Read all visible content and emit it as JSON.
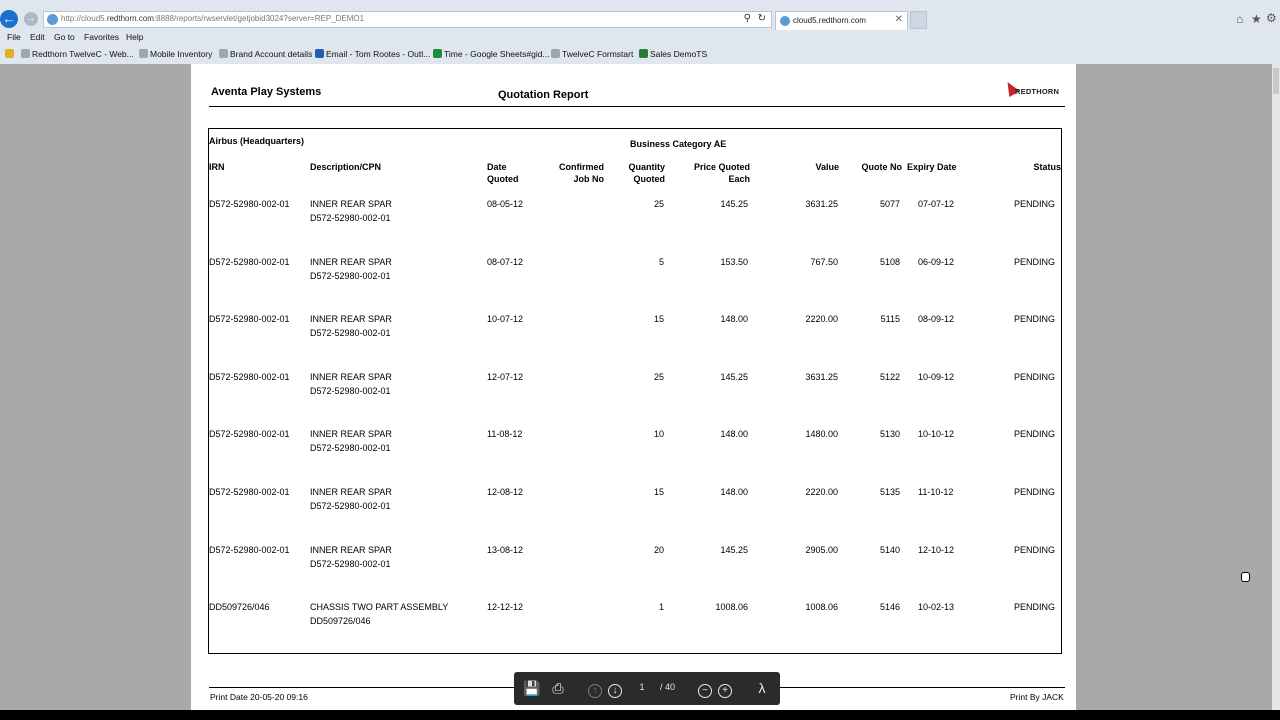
{
  "browser": {
    "url_prefix": "http://cloud5.",
    "url_domain": "redthorn.com",
    "url_suffix": ":8888/reports/rwservlet/getjobid3024?server=REP_DEMO1",
    "tab_title": "cloud5.redthorn.com",
    "menu": [
      "File",
      "Edit",
      "Go to",
      "Favorites",
      "Help"
    ],
    "favorites": [
      "Redthorn TwelveC - Web...",
      "Mobile Inventory",
      "Brand Account details",
      "Email - Tom Rootes - Outl...",
      "Time - Google Sheets#gid...",
      "TwelveC Formstart",
      "Sales DemoTS"
    ]
  },
  "report": {
    "company": "Aventa Play Systems",
    "title": "Quotation Report",
    "logo_text": "REDTHORN",
    "customer": "Airbus (Headquarters)",
    "category": "Business Category AE",
    "columns": {
      "irn": "IRN",
      "description": "Description/CPN",
      "date_quoted_1": "Date",
      "date_quoted_2": "Quoted",
      "confirmed_1": "Confirmed",
      "confirmed_2": "Job No",
      "quantity_1": "Quantity",
      "quantity_2": "Quoted",
      "price_1": "Price  Quoted",
      "price_2": "Each",
      "value": "Value",
      "quote_no": "Quote No",
      "expiry": "Expiry Date",
      "status": "Status"
    },
    "rows": [
      {
        "irn": "D572-52980-002-01",
        "desc": "INNER REAR SPAR",
        "cpn": "D572-52980-002-01",
        "date": "08-05-12",
        "qty": "25",
        "price": "145.25",
        "value": "3631.25",
        "quote_no": "5077",
        "expiry": "07-07-12",
        "status": "PENDING"
      },
      {
        "irn": "D572-52980-002-01",
        "desc": "INNER REAR SPAR",
        "cpn": "D572-52980-002-01",
        "date": "08-07-12",
        "qty": "5",
        "price": "153.50",
        "value": "767.50",
        "quote_no": "5108",
        "expiry": "06-09-12",
        "status": "PENDING"
      },
      {
        "irn": "D572-52980-002-01",
        "desc": "INNER REAR SPAR",
        "cpn": "D572-52980-002-01",
        "date": "10-07-12",
        "qty": "15",
        "price": "148.00",
        "value": "2220.00",
        "quote_no": "5115",
        "expiry": "08-09-12",
        "status": "PENDING"
      },
      {
        "irn": "D572-52980-002-01",
        "desc": "INNER REAR SPAR",
        "cpn": "D572-52980-002-01",
        "date": "12-07-12",
        "qty": "25",
        "price": "145.25",
        "value": "3631.25",
        "quote_no": "5122",
        "expiry": "10-09-12",
        "status": "PENDING"
      },
      {
        "irn": "D572-52980-002-01",
        "desc": "INNER REAR SPAR",
        "cpn": "D572-52980-002-01",
        "date": "11-08-12",
        "qty": "10",
        "price": "148.00",
        "value": "1480.00",
        "quote_no": "5130",
        "expiry": "10-10-12",
        "status": "PENDING"
      },
      {
        "irn": "D572-52980-002-01",
        "desc": "INNER REAR SPAR",
        "cpn": "D572-52980-002-01",
        "date": "12-08-12",
        "qty": "15",
        "price": "148.00",
        "value": "2220.00",
        "quote_no": "5135",
        "expiry": "11-10-12",
        "status": "PENDING"
      },
      {
        "irn": "D572-52980-002-01",
        "desc": "INNER REAR SPAR",
        "cpn": "D572-52980-002-01",
        "date": "13-08-12",
        "qty": "20",
        "price": "145.25",
        "value": "2905.00",
        "quote_no": "5140",
        "expiry": "12-10-12",
        "status": "PENDING"
      },
      {
        "irn": "DD509726/046",
        "desc": "CHASSIS TWO PART ASSEMBLY",
        "cpn": "DD509726/046",
        "date": "12-12-12",
        "qty": "1",
        "price": "1008.06",
        "value": "1008.06",
        "quote_no": "5146",
        "expiry": "10-02-13",
        "status": "PENDING"
      }
    ],
    "print_date": "Print Date 20-05-20 09:16",
    "print_by": "Print By  JACK"
  },
  "pdf_toolbar": {
    "page": "1",
    "total": "/  40",
    "icons": [
      "save-icon",
      "print-icon",
      "page-up-icon",
      "page-down-icon",
      "zoom-out-icon",
      "zoom-in-icon",
      "adobe-acrobat-icon"
    ]
  }
}
